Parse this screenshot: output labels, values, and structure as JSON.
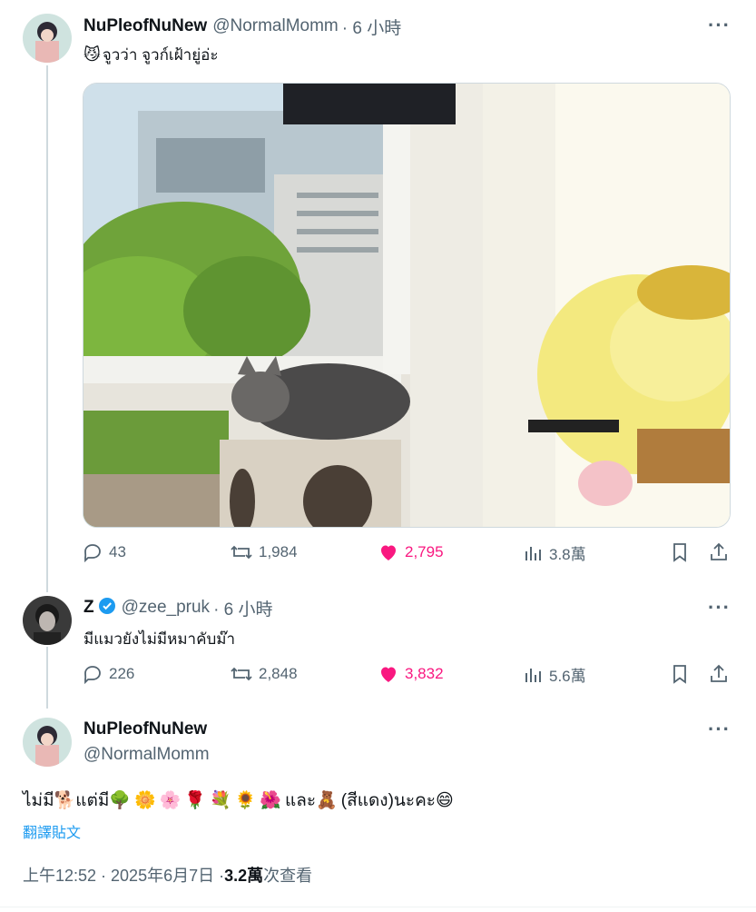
{
  "tweet1": {
    "display_name": "NuPleofNuNew",
    "handle": "@NormalMomm",
    "time": "· 6 小時",
    "emoji": "😼",
    "text": "จูวว่า จูวก์เฝ้ายู่อ่ะ",
    "more": "···",
    "stats": {
      "replies": "43",
      "retweets": "1,984",
      "likes": "2,795",
      "views": "3.8萬"
    }
  },
  "tweet2": {
    "display_name": "Z",
    "handle": "@zee_pruk",
    "time": "· 6 小時",
    "text": "มีแมวยังไม่มีหมาคับม๊า",
    "more": "···",
    "stats": {
      "replies": "226",
      "retweets": "2,848",
      "likes": "3,832",
      "views": "5.6萬"
    }
  },
  "tweet3": {
    "display_name": "NuPleofNuNew",
    "handle": "@NormalMomm",
    "more": "···",
    "text_part1": "ไม่มี",
    "emoji_dog": "🐕",
    "text_part2": "แต่มี",
    "emoji_flowers": "🌳🌼🌸🌹💐🌻🌺",
    "text_part3": "และ",
    "emoji_bear": "🧸",
    "text_part4": "(สีแดง)นะคะ",
    "emoji_smile": "😄",
    "translate": "翻譯貼文",
    "timestamp": "上午12:52 · 2025年6月7日 · ",
    "views_count": "3.2萬",
    "views_label": " 次查看"
  },
  "colors": {
    "like_pink": "#f91880",
    "verified_blue": "#1d9bf0",
    "link_blue": "#1d9bf0",
    "muted": "#536471"
  }
}
